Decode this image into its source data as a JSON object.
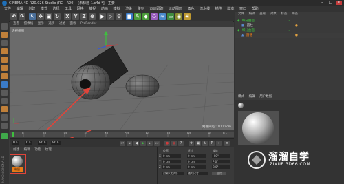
{
  "titlebar": {
    "title": "CINEMA 4D R20.026 Studio (RC - R20) - [未标题 1.c4d *] - 主要"
  },
  "menubar": {
    "items": [
      "文件",
      "编辑",
      "创建",
      "模式",
      "选择",
      "工具",
      "网格",
      "捕捉",
      "动画",
      "模拟",
      "渲染",
      "雕刻",
      "运动跟踪",
      "运动图形",
      "角色",
      "流水线",
      "插件",
      "脚本",
      "窗口",
      "帮助"
    ]
  },
  "toolbar": {
    "x": "X",
    "y": "Y",
    "z": "Z"
  },
  "viewport": {
    "menu": [
      "查看",
      "摄像机",
      "显示",
      "选项",
      "过滤",
      "面板",
      "ProRender"
    ],
    "label": "透视视图",
    "grid_distance": "网格间距 : 1000 cm"
  },
  "timeline": {
    "ticks": [
      "0",
      "10",
      "20",
      "30",
      "40",
      "50",
      "60",
      "70",
      "80",
      "90"
    ],
    "end_label": "0 F"
  },
  "playbar": {
    "current": "0 F",
    "start": "0 F",
    "end": "90 F",
    "max": "90 F"
  },
  "material_manager": {
    "menu": [
      "创建",
      "编辑",
      "功能",
      "纹理"
    ],
    "material_name": "材质"
  },
  "attributes": {
    "headers": [
      "位置",
      "尺寸",
      "旋转"
    ],
    "rows": [
      {
        "axis": "X",
        "pos": "0 cm",
        "size": "0 cm",
        "rot": "H 0°"
      },
      {
        "axis": "Y",
        "pos": "0 cm",
        "size": "0 cm",
        "rot": "P 0°"
      },
      {
        "axis": "Z",
        "pos": "0 cm",
        "size": "0 cm",
        "rot": "B 0°"
      }
    ],
    "mode": "对象 (相对)",
    "size_mode": "绝对尺寸",
    "apply": "应用"
  },
  "object_manager": {
    "tabs": [
      "文件",
      "编辑",
      "查看",
      "对象",
      "标签",
      "书签"
    ],
    "objects": [
      "细分曲面",
      "圆柱",
      "圆锥",
      "细分曲面"
    ]
  },
  "attr_manager_tabs": [
    "模式",
    "编辑",
    "用户数据"
  ],
  "watermark": {
    "brand": "溜溜自学",
    "url": "ZIXUE.3D66.COM"
  },
  "colors": {
    "accent": "#e87b17",
    "arrow": "#e0443a",
    "highlight_box": "#e0443a"
  }
}
